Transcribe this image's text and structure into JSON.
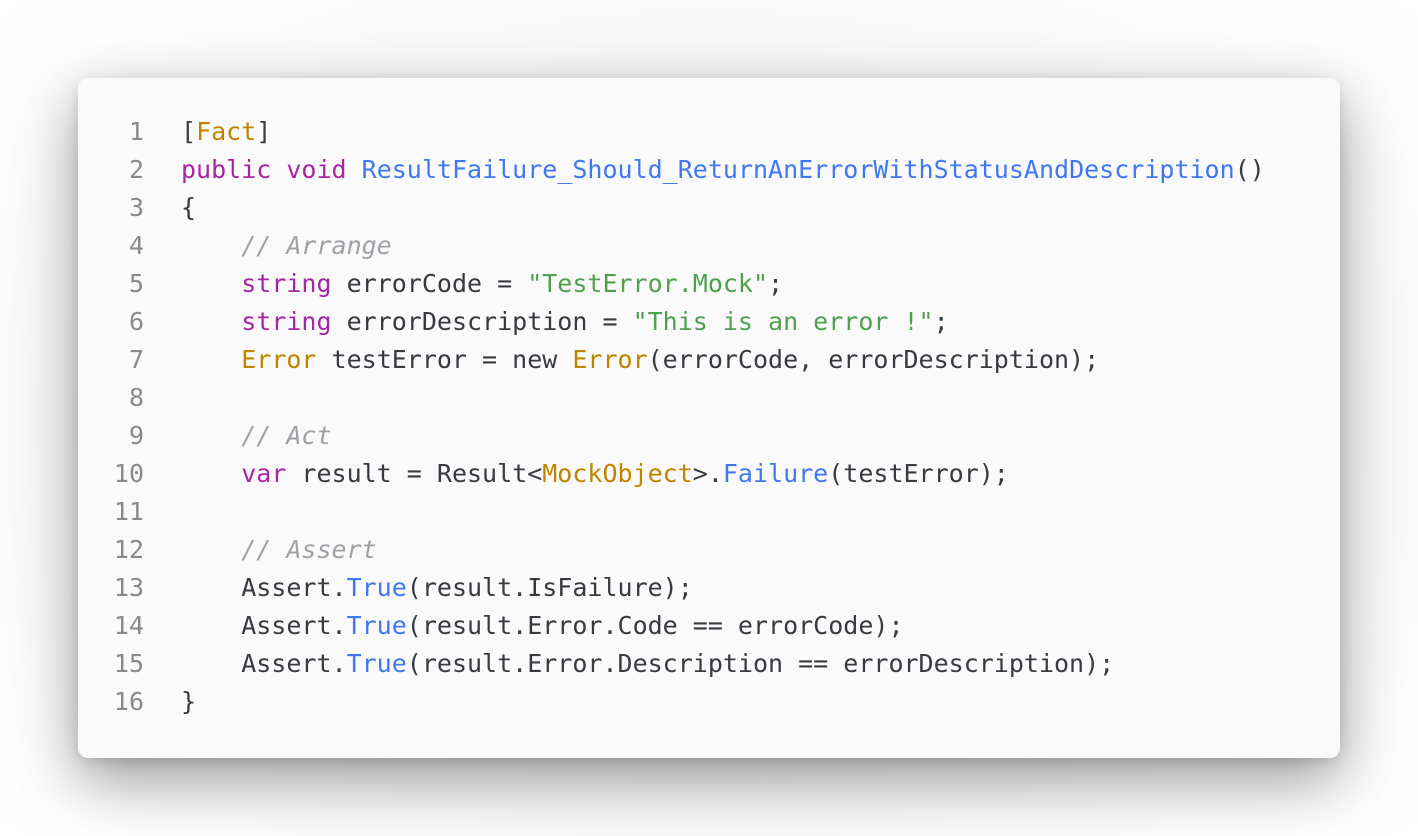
{
  "colors": {
    "background": "#fafafa",
    "keyword": "#a626a4",
    "type": "#c18401",
    "function": "#4078f2",
    "string": "#50a14f",
    "comment": "#a0a1a7",
    "plain": "#383a42",
    "line_number": "#8a8a8a"
  },
  "code": {
    "lines": [
      {
        "number": "1",
        "tokens": [
          {
            "text": "[",
            "kind": "plain"
          },
          {
            "text": "Fact",
            "kind": "type"
          },
          {
            "text": "]",
            "kind": "plain"
          }
        ]
      },
      {
        "number": "2",
        "tokens": [
          {
            "text": "public",
            "kind": "keyword"
          },
          {
            "text": " ",
            "kind": "plain"
          },
          {
            "text": "void",
            "kind": "keyword"
          },
          {
            "text": " ",
            "kind": "plain"
          },
          {
            "text": "ResultFailure_Should_ReturnAnErrorWithStatusAndDescription",
            "kind": "function"
          },
          {
            "text": "()",
            "kind": "plain"
          }
        ]
      },
      {
        "number": "3",
        "tokens": [
          {
            "text": "{",
            "kind": "plain"
          }
        ]
      },
      {
        "number": "4",
        "tokens": [
          {
            "text": "    ",
            "kind": "plain"
          },
          {
            "text": "// Arrange",
            "kind": "comment"
          }
        ]
      },
      {
        "number": "5",
        "tokens": [
          {
            "text": "    ",
            "kind": "plain"
          },
          {
            "text": "string",
            "kind": "keyword"
          },
          {
            "text": " errorCode = ",
            "kind": "plain"
          },
          {
            "text": "\"TestError.Mock\"",
            "kind": "string"
          },
          {
            "text": ";",
            "kind": "plain"
          }
        ]
      },
      {
        "number": "6",
        "tokens": [
          {
            "text": "    ",
            "kind": "plain"
          },
          {
            "text": "string",
            "kind": "keyword"
          },
          {
            "text": " errorDescription = ",
            "kind": "plain"
          },
          {
            "text": "\"This is an error !\"",
            "kind": "string"
          },
          {
            "text": ";",
            "kind": "plain"
          }
        ]
      },
      {
        "number": "7",
        "tokens": [
          {
            "text": "    ",
            "kind": "plain"
          },
          {
            "text": "Error",
            "kind": "type"
          },
          {
            "text": " testError = new ",
            "kind": "plain"
          },
          {
            "text": "Error",
            "kind": "type"
          },
          {
            "text": "(errorCode, errorDescription);",
            "kind": "plain"
          }
        ]
      },
      {
        "number": "8",
        "tokens": []
      },
      {
        "number": "9",
        "tokens": [
          {
            "text": "    ",
            "kind": "plain"
          },
          {
            "text": "// Act",
            "kind": "comment"
          }
        ]
      },
      {
        "number": "10",
        "tokens": [
          {
            "text": "    ",
            "kind": "plain"
          },
          {
            "text": "var",
            "kind": "keyword"
          },
          {
            "text": " result = Result<",
            "kind": "plain"
          },
          {
            "text": "MockObject",
            "kind": "type"
          },
          {
            "text": ">.",
            "kind": "plain"
          },
          {
            "text": "Failure",
            "kind": "function"
          },
          {
            "text": "(testError);",
            "kind": "plain"
          }
        ]
      },
      {
        "number": "11",
        "tokens": []
      },
      {
        "number": "12",
        "tokens": [
          {
            "text": "    ",
            "kind": "plain"
          },
          {
            "text": "// Assert",
            "kind": "comment"
          }
        ]
      },
      {
        "number": "13",
        "tokens": [
          {
            "text": "    Assert.",
            "kind": "plain"
          },
          {
            "text": "True",
            "kind": "function"
          },
          {
            "text": "(result.IsFailure);",
            "kind": "plain"
          }
        ]
      },
      {
        "number": "14",
        "tokens": [
          {
            "text": "    Assert.",
            "kind": "plain"
          },
          {
            "text": "True",
            "kind": "function"
          },
          {
            "text": "(result.Error.Code == errorCode);",
            "kind": "plain"
          }
        ]
      },
      {
        "number": "15",
        "tokens": [
          {
            "text": "    Assert.",
            "kind": "plain"
          },
          {
            "text": "True",
            "kind": "function"
          },
          {
            "text": "(result.Error.Description == errorDescription);",
            "kind": "plain"
          }
        ]
      },
      {
        "number": "16",
        "tokens": [
          {
            "text": "}",
            "kind": "plain"
          }
        ]
      }
    ]
  }
}
